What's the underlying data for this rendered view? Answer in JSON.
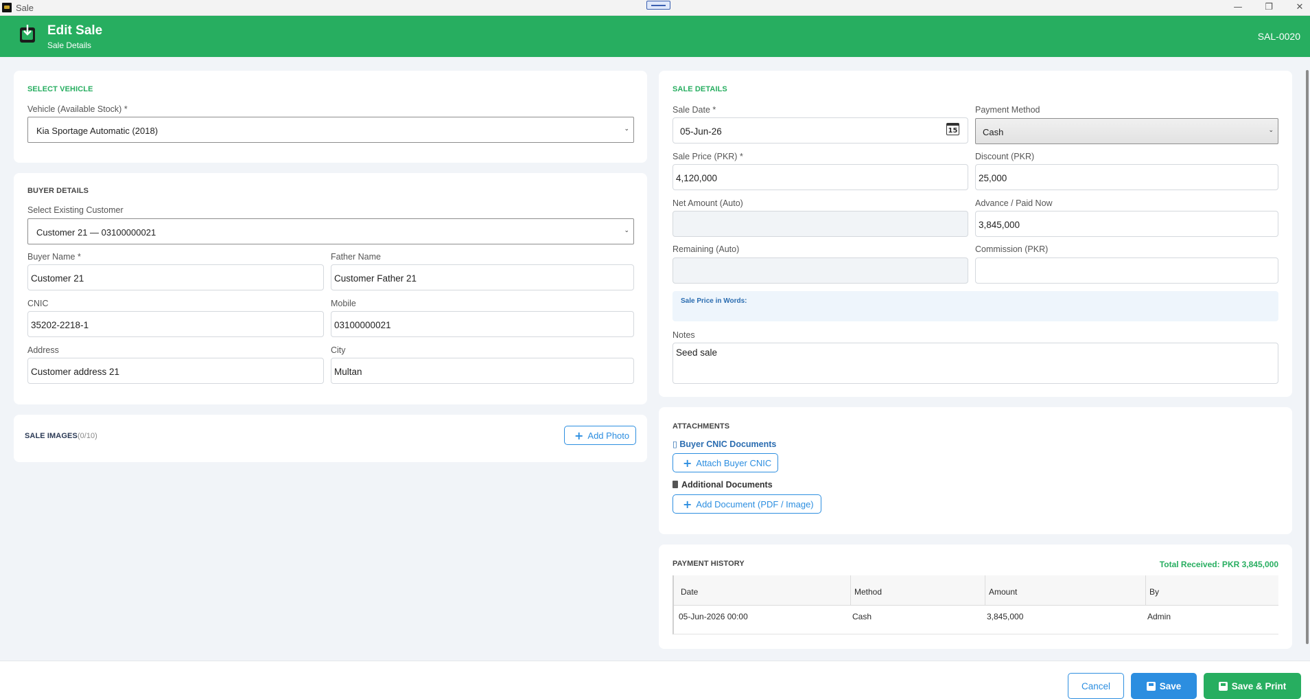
{
  "window": {
    "title": "Sale",
    "minimize": "—",
    "restore": "❐",
    "close": "✕"
  },
  "header": {
    "title": "Edit Sale",
    "subtitle": "Sale Details",
    "code": "SAL-0020",
    "icon": "sale-document-icon"
  },
  "vehicle": {
    "section": "SELECT VEHICLE",
    "label": "Vehicle (Available Stock) *",
    "value": "Kia Sportage Automatic (2018)"
  },
  "buyer": {
    "section": "BUYER DETAILS",
    "customer_label": "Select Existing Customer",
    "customer_value": "Customer 21 — 03100000021",
    "name_label": "Buyer Name *",
    "name_value": "Customer 21",
    "father_label": "Father Name",
    "father_value": "Customer Father 21",
    "cnic_label": "CNIC",
    "cnic_value": "35202-2218-1",
    "mobile_label": "Mobile",
    "mobile_value": "03100000021",
    "address_label": "Address",
    "address_value": "Customer address 21",
    "city_label": "City",
    "city_value": "Multan"
  },
  "images": {
    "section": "SALE IMAGES",
    "count": "(0/10)",
    "add_label": "Add Photo"
  },
  "sale": {
    "section": "SALE DETAILS",
    "date_label": "Sale Date *",
    "date_value": "05-Jun-26",
    "calendar_day": "15",
    "payment_label": "Payment Method",
    "payment_value": "Cash",
    "price_label": "Sale Price (PKR) *",
    "price_value": "4,120,000",
    "discount_label": "Discount (PKR)",
    "discount_value": "25,000",
    "net_label": "Net Amount (Auto)",
    "net_value": "",
    "advance_label": "Advance / Paid Now",
    "advance_value": "3,845,000",
    "remaining_label": "Remaining (Auto)",
    "remaining_value": "",
    "commission_label": "Commission (PKR)",
    "commission_value": "",
    "words_label": "Sale Price in Words:",
    "notes_label": "Notes",
    "notes_value": "Seed sale"
  },
  "attachments": {
    "section": "ATTACHMENTS",
    "cnic_heading": "Buyer CNIC Documents",
    "cnic_icon": "▯",
    "attach_cnic": "Attach Buyer CNIC",
    "additional_heading": "Additional Documents",
    "add_document": "Add Document (PDF / Image)"
  },
  "payments": {
    "section": "PAYMENT HISTORY",
    "total": "Total Received: PKR 3,845,000",
    "columns": [
      "Date",
      "Method",
      "Amount",
      "By"
    ],
    "rows": [
      [
        "05-Jun-2026 00:00",
        "Cash",
        "3,845,000",
        "Admin"
      ]
    ]
  },
  "footer": {
    "cancel": "Cancel",
    "save": "Save",
    "save_print": "Save & Print"
  },
  "colors": {
    "brand": "#27ae60",
    "accent": "#2c8ee0"
  }
}
